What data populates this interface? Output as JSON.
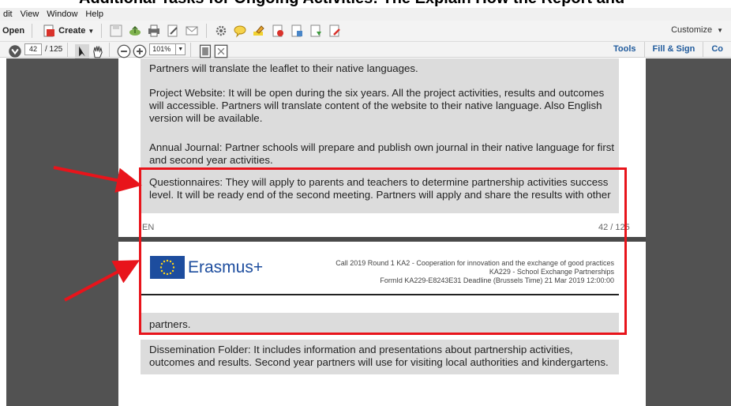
{
  "heading_strip": "Additional Tasks for Ongoing Activities: The Explain How the Report and",
  "menubar": {
    "items": [
      "dit",
      "View",
      "Window",
      "Help"
    ]
  },
  "toolbar1": {
    "open_label": "Open",
    "create_label": "Create",
    "customize_label": "Customize"
  },
  "toolbar2": {
    "page_current": "42",
    "page_total": "/ 125",
    "zoom": "101%",
    "tools_label": "Tools",
    "fill_sign_label": "Fill & Sign",
    "comment_label": "Co"
  },
  "page1": {
    "line_leaflet": "Partners will translate the leaflet to their native languages.",
    "para_website": "Project Website: It will be open during the six years. All the project activities, results and outcomes will accessible. Partners will translate content of the website to their native language. Also English version will be available.",
    "para_journal": "Annual Journal: Partner schools will prepare and publish own journal in their native language for first and second year activities.",
    "para_questionnaires": "Questionnaires: They will apply to parents and teachers to determine partnership activities success level. It will be ready end of the second meeting. Partners will apply and share the results with other",
    "footer_lang": "EN",
    "footer_page": "42 / 125"
  },
  "page2": {
    "logo_text": "Erasmus+",
    "call_line1": "Call 2019 Round 1 KA2 - Cooperation for innovation and the exchange of good practices",
    "call_line2": "KA229 - School Exchange Partnerships",
    "call_line3": "FormId KA229-E8243E31 Deadline (Brussels Time) 21 Mar 2019 12:00:00",
    "partners_text": "partners.",
    "para_folder": "Dissemination Folder: It includes information and presentations about partnership activities, outcomes and results. Second year partners will use for visiting local authorities and kindergartens."
  },
  "colors": {
    "annotation_red": "#e8141b",
    "eu_blue": "#1d4d9e",
    "viewer_bg": "#525252"
  }
}
